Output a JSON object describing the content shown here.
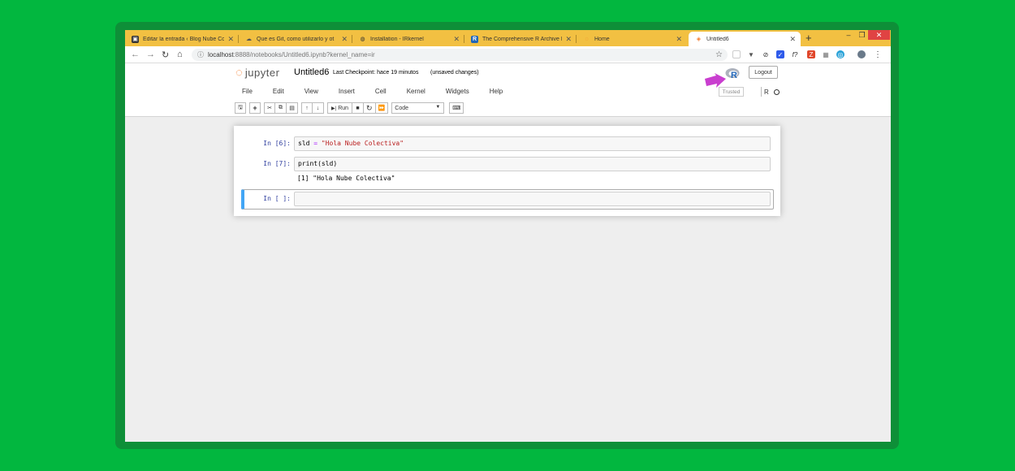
{
  "browser": {
    "tabs": [
      {
        "title": "Editar la entrada ‹ Blog Nube Co",
        "favicon": "wordpress-icon"
      },
      {
        "title": "Que es Git, como utilizarlo y ot",
        "favicon": "cloud-icon"
      },
      {
        "title": "Installation - IRkernel",
        "favicon": "globe-icon"
      },
      {
        "title": "The Comprehensive R Archive N",
        "favicon": "r-logo-icon"
      },
      {
        "title": "Home",
        "favicon": "jupyter-icon"
      },
      {
        "title": "Untitled6",
        "favicon": "notebook-icon"
      }
    ],
    "new_tab": "+",
    "minimize": "–",
    "restore": "❐",
    "close": "✕",
    "url_host": "localhost",
    "url_path": ":8888/notebooks/Untitled6.ipynb?kernel_name=ir"
  },
  "jupyter": {
    "logo_text": "jupyter",
    "notebook_name": "Untitled6",
    "checkpoint": "Last Checkpoint: hace 19 minutos",
    "unsaved": "(unsaved changes)",
    "logout": "Logout",
    "menu": [
      "File",
      "Edit",
      "View",
      "Insert",
      "Cell",
      "Kernel",
      "Widgets",
      "Help"
    ],
    "trusted": "Trusted",
    "kernel_name": "R",
    "run_label": "Run",
    "cell_type": "Code"
  },
  "cells": [
    {
      "prompt": "In [6]:",
      "code_parts": [
        "sld ",
        "= ",
        "\"Hola Nube Colectiva\""
      ],
      "output": ""
    },
    {
      "prompt": "In [7]:",
      "code_parts": [
        "print(sld)"
      ],
      "output": "[1] \"Hola Nube Colectiva\""
    },
    {
      "prompt": "In [ ]:",
      "code_parts": [
        ""
      ],
      "output": ""
    }
  ],
  "colors": {
    "background": "#02b73f",
    "tab_strip": "#f2c042",
    "selected_cell_border": "#42a5f5",
    "jupyter_orange": "#f37726",
    "annotation_arrow": "#c93ecf"
  }
}
